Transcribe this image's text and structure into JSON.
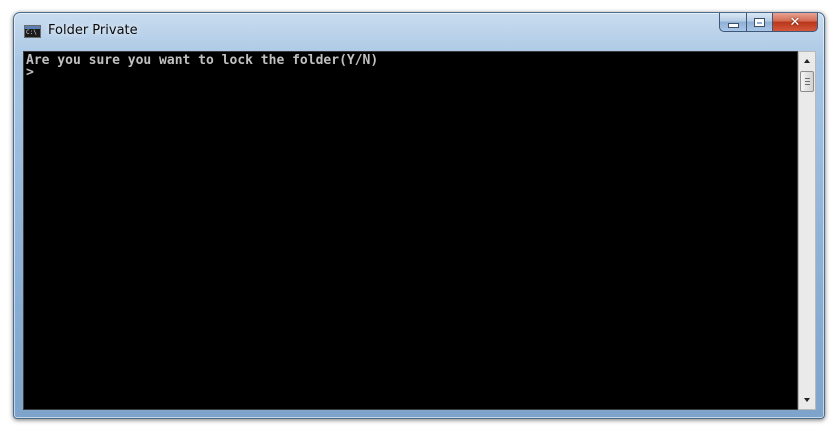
{
  "window": {
    "title": "Folder Private",
    "icon": "console-icon"
  },
  "caption_buttons": {
    "minimize": "minimize-icon",
    "maximize": "maximize-icon",
    "close": "close-icon",
    "close_color": "#c94a2e"
  },
  "console": {
    "lines": [
      "Are you sure you want to lock the folder(Y/N)",
      ">"
    ],
    "background_color": "#000000",
    "text_color": "#c0c0c0"
  },
  "scrollbar": {
    "up_icon": "arrow-up-icon",
    "down_icon": "arrow-down-icon"
  }
}
